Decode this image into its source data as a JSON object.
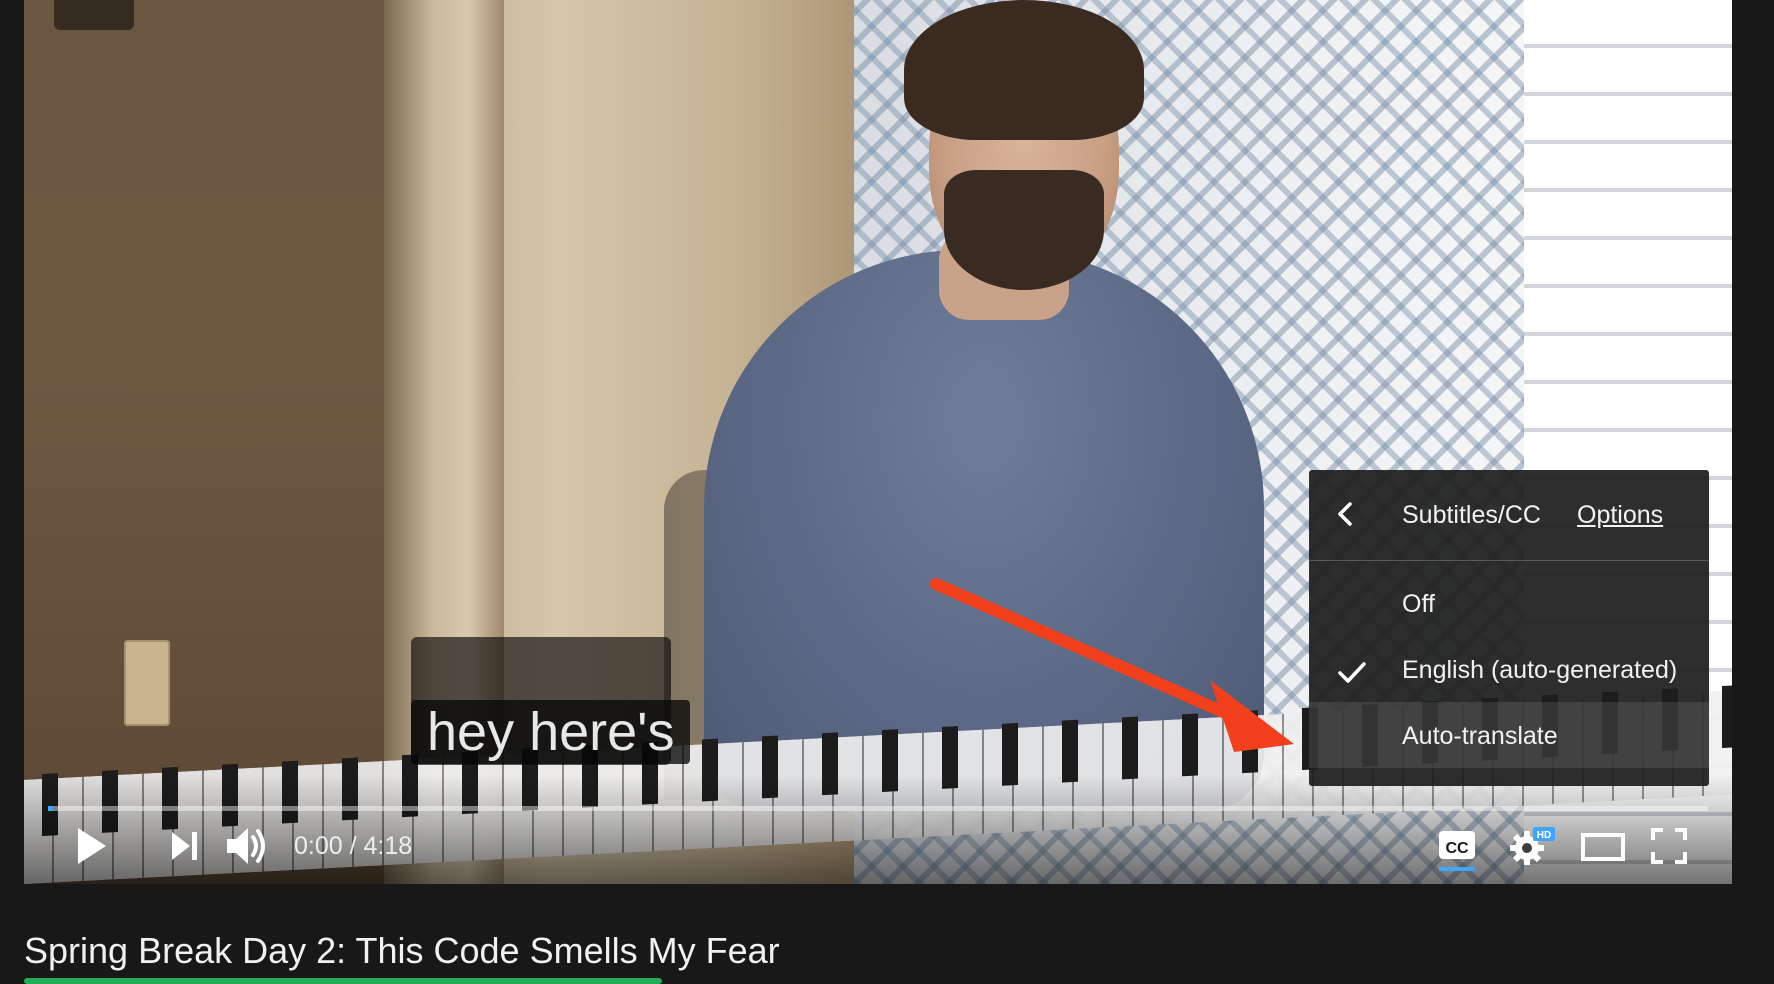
{
  "player": {
    "caption_text": "hey here's",
    "progress_fraction": 0.003,
    "time": {
      "current": "0:00",
      "separator": " / ",
      "duration": "4:18"
    },
    "controls": {
      "play_icon": "play-icon",
      "next_icon": "next-icon",
      "volume_icon": "volume-icon",
      "cc_label": "CC",
      "hd_badge": "HD",
      "settings_icon": "gear-icon",
      "theater_icon": "theater-mode-icon",
      "fullscreen_icon": "fullscreen-icon"
    },
    "colors": {
      "accent": "#3ea6ff",
      "annotation_arrow": "#f2401c"
    }
  },
  "subtitles_menu": {
    "title": "Subtitles/CC",
    "options_link": "Options",
    "items": [
      {
        "label": "Off",
        "selected": false
      },
      {
        "label": "English (auto-generated)",
        "selected": true
      },
      {
        "label": "Auto-translate",
        "selected": false,
        "highlighted": true
      }
    ]
  },
  "video_info": {
    "title": "Spring Break Day 2: This Code Smells My Fear"
  }
}
